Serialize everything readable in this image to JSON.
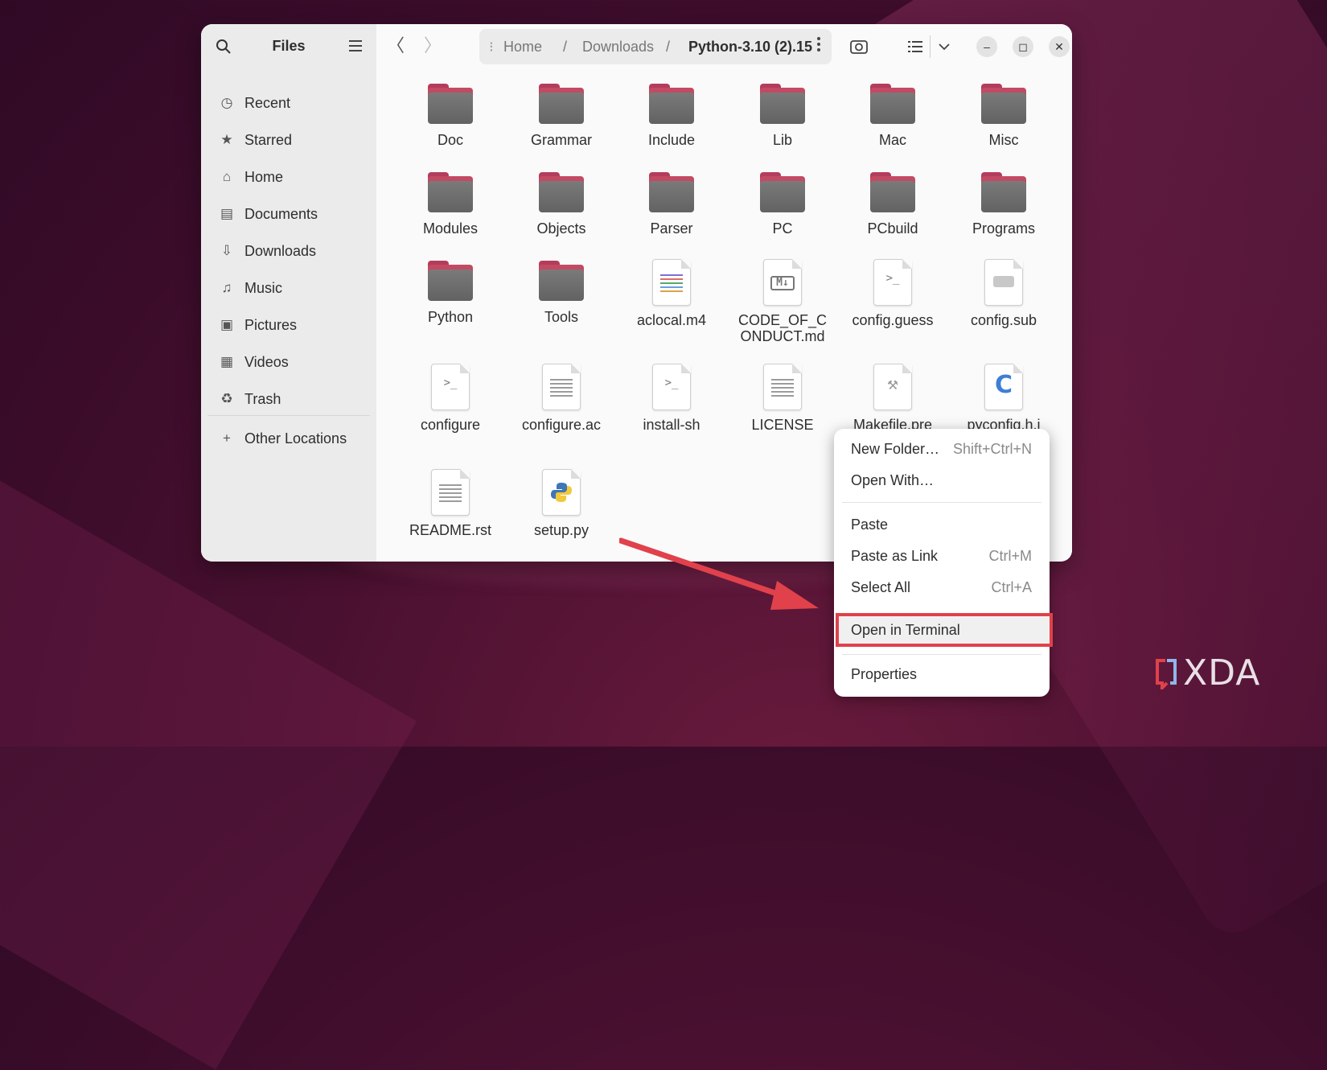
{
  "app": {
    "title": "Files"
  },
  "sidebar": {
    "items": [
      {
        "label": "Recent",
        "icon": "clock-icon"
      },
      {
        "label": "Starred",
        "icon": "star-icon"
      },
      {
        "label": "Home",
        "icon": "home-icon"
      },
      {
        "label": "Documents",
        "icon": "document-icon"
      },
      {
        "label": "Downloads",
        "icon": "download-icon"
      },
      {
        "label": "Music",
        "icon": "music-icon"
      },
      {
        "label": "Pictures",
        "icon": "picture-icon"
      },
      {
        "label": "Videos",
        "icon": "film-icon"
      },
      {
        "label": "Trash",
        "icon": "trash-icon"
      }
    ],
    "other_locations": "Other Locations"
  },
  "breadcrumb": {
    "home": "Home",
    "sep": "/",
    "downloads": "Downloads",
    "current": "Python-3.10 (2).15"
  },
  "files": [
    {
      "name": "Doc",
      "type": "folder"
    },
    {
      "name": "Grammar",
      "type": "folder"
    },
    {
      "name": "Include",
      "type": "folder"
    },
    {
      "name": "Lib",
      "type": "folder"
    },
    {
      "name": "Mac",
      "type": "folder"
    },
    {
      "name": "Misc",
      "type": "folder"
    },
    {
      "name": "Modules",
      "type": "folder"
    },
    {
      "name": "Objects",
      "type": "folder"
    },
    {
      "name": "Parser",
      "type": "folder"
    },
    {
      "name": "PC",
      "type": "folder"
    },
    {
      "name": "PCbuild",
      "type": "folder"
    },
    {
      "name": "Programs",
      "type": "folder"
    },
    {
      "name": "Python",
      "type": "folder"
    },
    {
      "name": "Tools",
      "type": "folder"
    },
    {
      "name": "aclocal.m4",
      "type": "text-color"
    },
    {
      "name": "CODE_OF_C",
      "name2": "ONDUCT.md",
      "type": "markdown"
    },
    {
      "name": "config.guess",
      "type": "script"
    },
    {
      "name": "config.sub",
      "type": "generic"
    },
    {
      "name": "configure",
      "type": "script"
    },
    {
      "name": "configure.ac",
      "type": "text"
    },
    {
      "name": "install-sh",
      "type": "script"
    },
    {
      "name": "LICENSE",
      "type": "text"
    },
    {
      "name": "Makefile.pre",
      "type": "makefile"
    },
    {
      "name": "pyconfig.h.i",
      "type": "c-source"
    },
    {
      "name": "README.rst",
      "type": "text"
    },
    {
      "name": "setup.py",
      "type": "python"
    }
  ],
  "context_menu": {
    "new_folder": "New Folder…",
    "new_folder_accel": "Shift+Ctrl+N",
    "open_with": "Open With…",
    "paste": "Paste",
    "paste_link": "Paste as Link",
    "paste_link_accel": "Ctrl+M",
    "select_all": "Select All",
    "select_all_accel": "Ctrl+A",
    "open_terminal": "Open in Terminal",
    "properties": "Properties"
  },
  "watermark": "XDA",
  "colors": {
    "highlight": "#e0414b",
    "folder_tab": "#c24a63",
    "arrow": "#e0414b"
  }
}
